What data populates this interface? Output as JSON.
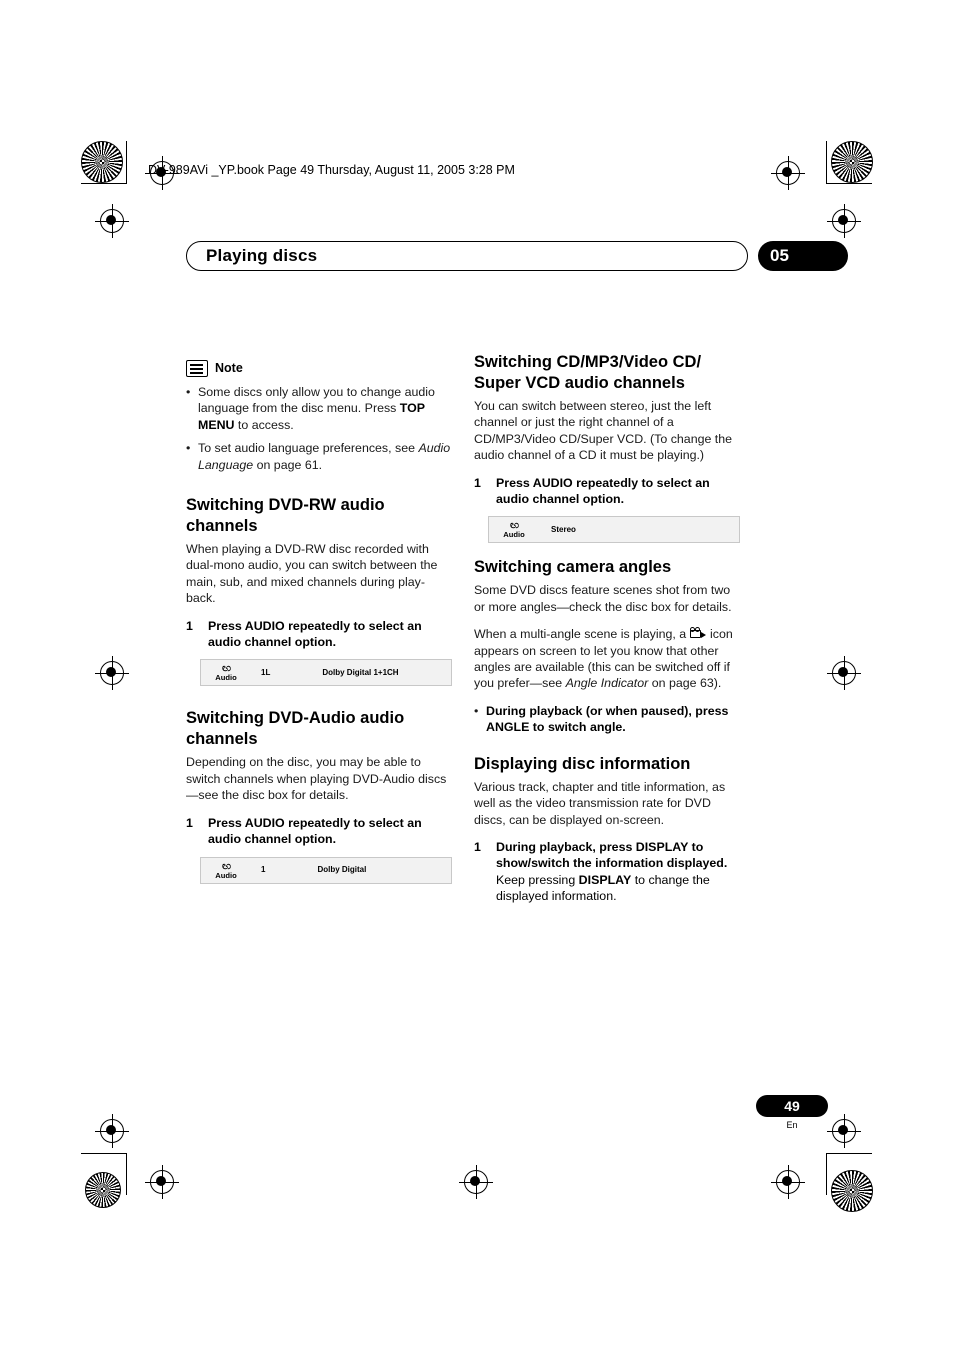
{
  "slug": "DV-989AVi _YP.book  Page 49  Thursday, August 11, 2005  3:28 PM",
  "header": {
    "title": "Playing discs",
    "chapter": "05"
  },
  "footer": {
    "page_number": "49",
    "language": "En"
  },
  "note": {
    "label": "Note",
    "items": [
      "Some discs only allow you to change audio language from the disc menu. Press TOP MENU to access.",
      "To set audio language preferences, see Audio Language on page 61."
    ],
    "item1_pre": "Some discs only allow you to change audio language from the disc menu. Press ",
    "item1_bold": "TOP MENU",
    "item1_post": " to access.",
    "item2_pre": "To set audio language preferences, see ",
    "item2_italic": "Audio Language",
    "item2_post": " on page 61."
  },
  "sections": {
    "dvd_rw": {
      "heading": "Switching DVD-RW audio channels",
      "body": "When playing a DVD-RW disc recorded with dual-mono audio, you can switch between the main, sub, and mixed channels during play-back.",
      "step_num": "1",
      "step_text": "Press AUDIO repeatedly to select an audio channel option.",
      "osd": {
        "icon_caption": "Audio",
        "channel": "1L",
        "format": "Dolby Digital 1+1CH"
      }
    },
    "dvd_audio": {
      "heading": "Switching DVD-Audio audio channels",
      "body": "Depending on the disc, you may be able to switch channels when playing DVD-Audio discs—see the disc box for details.",
      "step_num": "1",
      "step_text": "Press AUDIO repeatedly to select an audio channel option.",
      "osd": {
        "icon_caption": "Audio",
        "channel": "1",
        "format": "Dolby Digital"
      }
    },
    "cd_mp3": {
      "heading": "Switching CD/MP3/Video CD/ Super VCD audio channels",
      "body": "You can switch between stereo, just the left channel or just the right channel of a CD/MP3/Video CD/Super VCD. (To change the audio channel of a CD it must be playing.)",
      "step_num": "1",
      "step_text": "Press AUDIO repeatedly to select an audio channel option.",
      "osd": {
        "icon_caption": "Audio",
        "mode": "Stereo"
      }
    },
    "camera_angles": {
      "heading": "Switching camera angles",
      "body1": "Some DVD discs feature scenes shot from two or more angles—check the disc box for details.",
      "body2_pre": "When a multi-angle scene is playing, a ",
      "body2_mid": " icon appears on screen to let you know that other angles are available (this can be switched off if you prefer—see ",
      "body2_italic": "Angle Indicator",
      "body2_post": " on page 63).",
      "bullet": "During playback (or when paused), press ANGLE to switch angle."
    },
    "disc_info": {
      "heading": "Displaying disc information",
      "body": "Various track, chapter and title information, as well as the video transmission rate for DVD discs, can be displayed on-screen.",
      "step_num": "1",
      "step_bold": "During playback, press DISPLAY to show/switch the information displayed.",
      "step_after_pre": "Keep pressing ",
      "step_after_bold": "DISPLAY",
      "step_after_post": " to change the displayed information."
    }
  },
  "icons": {
    "note_icon": "note-icon",
    "audio_icon": "audio-disc-icon",
    "angle_icon": "camera-angle-icon"
  }
}
